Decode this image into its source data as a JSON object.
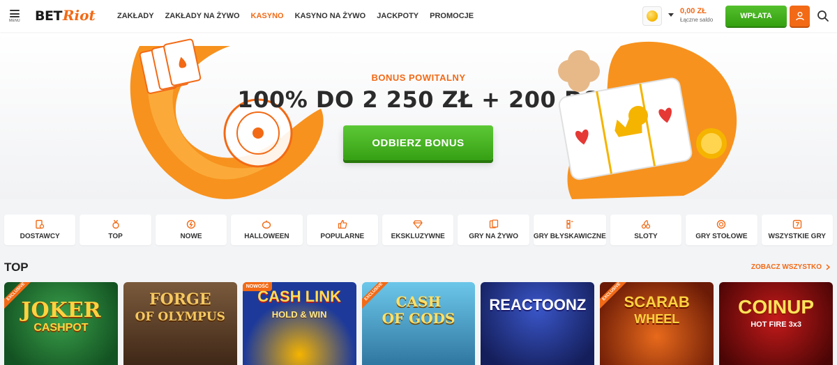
{
  "header": {
    "menu_label": "MENU",
    "logo_bet": "BET",
    "logo_riot": "Riot",
    "nav": [
      {
        "label": "ZAKŁADY",
        "active": false
      },
      {
        "label": "ZAKŁADY NA ŻYWO",
        "active": false
      },
      {
        "label": "KASYNO",
        "active": true
      },
      {
        "label": "KASYNO NA ŻYWO",
        "active": false
      },
      {
        "label": "JACKPOTY",
        "active": false
      },
      {
        "label": "PROMOCJE",
        "active": false
      }
    ],
    "balance_amount": "0,00 ZŁ",
    "balance_label": "Łączne saldo",
    "deposit_label": "WPŁATA"
  },
  "banner": {
    "eyebrow": "BONUS POWITALNY",
    "headline": "100% DO 2 250 ZŁ + 200 DS",
    "cta_label": "ODBIERZ BONUS"
  },
  "categories": [
    {
      "label": "DOSTAWCY",
      "icon": "providers-icon"
    },
    {
      "label": "TOP",
      "icon": "medal-icon"
    },
    {
      "label": "NOWE",
      "icon": "new-icon"
    },
    {
      "label": "HALLOWEEN",
      "icon": "pumpkin-icon"
    },
    {
      "label": "POPULARNE",
      "icon": "thumbs-up-icon"
    },
    {
      "label": "EKSKLUZYWNE",
      "icon": "diamond-icon"
    },
    {
      "label": "GRY NA ŻYWO",
      "icon": "live-cards-icon"
    },
    {
      "label": "GRY BŁYSKAWICZNE",
      "icon": "lightning-icon"
    },
    {
      "label": "SLOTY",
      "icon": "cherries-icon"
    },
    {
      "label": "GRY STOŁOWE",
      "icon": "chip-icon"
    },
    {
      "label": "WSZYSTKIE GRY",
      "icon": "all-games-icon"
    }
  ],
  "section": {
    "title": "TOP",
    "see_all": "ZOBACZ WSZYSTKO"
  },
  "games": [
    {
      "title_line1": "JOKER",
      "title_line2": "CASHPOT",
      "badge": "EXCLUSIVE",
      "bg": "#1f6b2e"
    },
    {
      "title_line1": "FORGE",
      "title_line2": "OF OLYMPUS",
      "badge": "",
      "bg": "#5a3a22"
    },
    {
      "title_line1": "CASH LINK",
      "title_line2": "HOLD & WIN",
      "badge": "NOWOŚĆ",
      "bg": "#1d3a9a"
    },
    {
      "title_line1": "CASH",
      "title_line2": "OF GODS",
      "badge": "EXCLUSIVE",
      "bg": "#2a8fb8"
    },
    {
      "title_line1": "REACTOONZ",
      "title_line2": "",
      "badge": "",
      "bg": "#1c2b78"
    },
    {
      "title_line1": "SCARAB",
      "title_line2": "WHEEL",
      "badge": "EXCLUSIVE",
      "bg": "#a33a10"
    },
    {
      "title_line1": "COINUP",
      "title_line2": "HOT FIRE 3x3",
      "badge": "",
      "bg": "#7a0d0d"
    }
  ],
  "colors": {
    "accent": "#f26a16",
    "cta_green": "#3fae1a",
    "dark_text": "#2b2b2b"
  }
}
